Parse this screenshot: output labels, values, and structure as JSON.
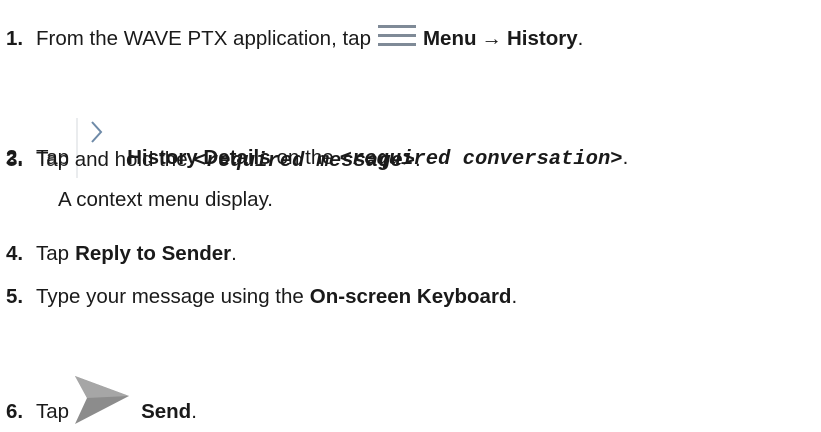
{
  "steps": [
    {
      "num": "1.",
      "t1": "From the WAVE PTX application, tap",
      "b1": "Menu",
      "arrow": "→",
      "b2": "History",
      "end": "."
    },
    {
      "num": "2.",
      "t1": "Tap",
      "b1": "History Details",
      "t2": "on the",
      "code": "<required conversation>",
      "end": "."
    },
    {
      "num": "3.",
      "t1": "Tap and hold the",
      "code": "<required message>",
      "end": ".",
      "note": "A context menu display."
    },
    {
      "num": "4.",
      "t1": "Tap",
      "b1": "Reply to Sender",
      "end": "."
    },
    {
      "num": "5.",
      "t1": "Type your message using the",
      "b1": "On-screen Keyboard",
      "end": "."
    },
    {
      "num": "6.",
      "t1": "Tap",
      "b1": "Send",
      "end": "."
    }
  ],
  "icons": {
    "menu": "menu-icon",
    "history_details": "chevron-right-icon",
    "send": "send-icon",
    "icon_color": "#7f8a97",
    "send_color": "#8c8c8c"
  }
}
